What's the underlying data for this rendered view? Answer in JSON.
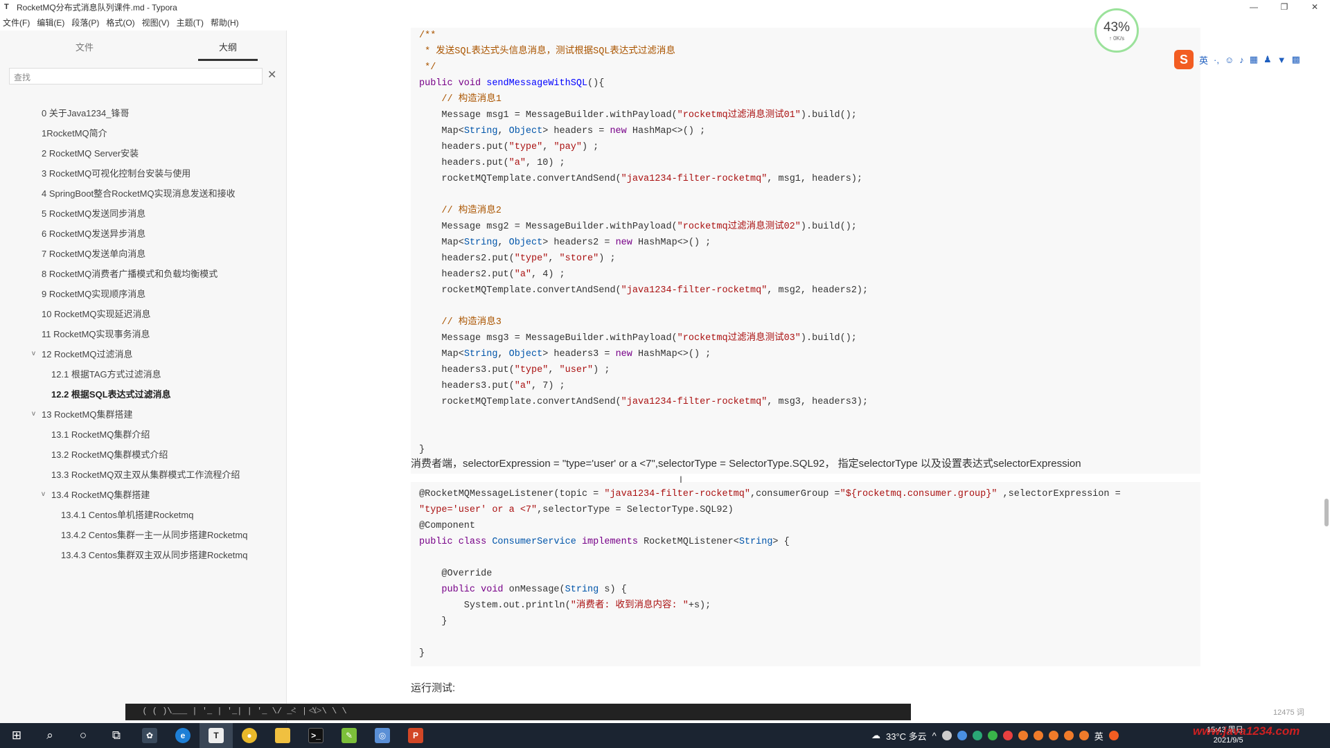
{
  "window": {
    "app_icon": "T",
    "title": "RocketMQ分布式消息队列课件.md - Typora",
    "controls": [
      "—",
      "❐",
      "✕"
    ]
  },
  "menu": [
    "文件(F)",
    "编辑(E)",
    "段落(P)",
    "格式(O)",
    "视图(V)",
    "主题(T)",
    "帮助(H)"
  ],
  "sidebar": {
    "tabs": [
      "文件",
      "大纲"
    ],
    "active_tab": "大纲",
    "search_placeholder": "查找",
    "outline": [
      {
        "label": "0 关于Java1234_锋哥",
        "level": 1,
        "chev": ""
      },
      {
        "label": "1RocketMQ简介",
        "level": 1,
        "chev": ""
      },
      {
        "label": "2 RocketMQ Server安装",
        "level": 1,
        "chev": ""
      },
      {
        "label": "3 RocketMQ可视化控制台安装与使用",
        "level": 1,
        "chev": ""
      },
      {
        "label": "4 SpringBoot整合RocketMQ实现消息发送和接收",
        "level": 1,
        "chev": ""
      },
      {
        "label": "5 RocketMQ发送同步消息",
        "level": 1,
        "chev": ""
      },
      {
        "label": "6 RocketMQ发送异步消息",
        "level": 1,
        "chev": ""
      },
      {
        "label": "7 RocketMQ发送单向消息",
        "level": 1,
        "chev": ""
      },
      {
        "label": "8 RocketMQ消费者广播模式和负载均衡模式",
        "level": 1,
        "chev": ""
      },
      {
        "label": "9 RocketMQ实现顺序消息",
        "level": 1,
        "chev": ""
      },
      {
        "label": "10 RocketMQ实现延迟消息",
        "level": 1,
        "chev": ""
      },
      {
        "label": "11 RocketMQ实现事务消息",
        "level": 1,
        "chev": ""
      },
      {
        "label": "12 RocketMQ过滤消息",
        "level": 1,
        "chev": "v"
      },
      {
        "label": "12.1 根据TAG方式过滤消息",
        "level": 2,
        "chev": ""
      },
      {
        "label": "12.2 根据SQL表达式过滤消息",
        "level": 2,
        "chev": "",
        "bold": true
      },
      {
        "label": "13 RocketMQ集群搭建",
        "level": 1,
        "chev": "v"
      },
      {
        "label": "13.1 RocketMQ集群介绍",
        "level": 2,
        "chev": ""
      },
      {
        "label": "13.2 RocketMQ集群模式介绍",
        "level": 2,
        "chev": ""
      },
      {
        "label": "13.3 RocketMQ双主双从集群模式工作流程介绍",
        "level": 2,
        "chev": ""
      },
      {
        "label": "13.4 RocketMQ集群搭建",
        "level": 2,
        "chev": "v"
      },
      {
        "label": "13.4.1 Centos单机搭建Rocketmq",
        "level": 3,
        "chev": ""
      },
      {
        "label": "13.4.2 Centos集群一主一从同步搭建Rocketmq",
        "level": 3,
        "chev": ""
      },
      {
        "label": "13.4.3 Centos集群双主双从同步搭建Rocketmq",
        "level": 3,
        "chev": ""
      }
    ],
    "footer_left": "<",
    "footer_code": "</>"
  },
  "code1": [
    [
      [
        "cmt",
        "/**"
      ]
    ],
    [
      [
        "cmt",
        " * 发送SQL表达式头信息消息，测试根据SQL表达式过滤消息"
      ]
    ],
    [
      [
        "cmt",
        " */"
      ]
    ],
    [
      [
        "kw",
        "public void "
      ],
      [
        "fn",
        "sendMessageWithSQL"
      ],
      [
        "",
        "(){"
      ]
    ],
    [
      [
        "",
        "    "
      ],
      [
        "cmt",
        "// 构造消息1"
      ]
    ],
    [
      [
        "",
        "    Message msg1 = MessageBuilder.withPayload("
      ],
      [
        "str",
        "\"rocketmq过滤消息测试01\""
      ],
      [
        "",
        ").build();"
      ]
    ],
    [
      [
        "",
        "    Map<"
      ],
      [
        "typ",
        "String"
      ],
      [
        "",
        ", "
      ],
      [
        "typ",
        "Object"
      ],
      [
        "",
        "> headers = "
      ],
      [
        "kw",
        "new "
      ],
      [
        "",
        "HashMap<>() ;"
      ]
    ],
    [
      [
        "",
        "    headers.put("
      ],
      [
        "str",
        "\"type\""
      ],
      [
        "",
        ", "
      ],
      [
        "str",
        "\"pay\""
      ],
      [
        "",
        ") ;"
      ]
    ],
    [
      [
        "",
        "    headers.put("
      ],
      [
        "str",
        "\"a\""
      ],
      [
        "",
        ", 10) ;"
      ]
    ],
    [
      [
        "",
        "    rocketMQTemplate.convertAndSend("
      ],
      [
        "str",
        "\"java1234-filter-rocketmq\""
      ],
      [
        "",
        ", msg1, headers);"
      ]
    ],
    [
      [
        "",
        ""
      ]
    ],
    [
      [
        "",
        "    "
      ],
      [
        "cmt",
        "// 构造消息2"
      ]
    ],
    [
      [
        "",
        "    Message msg2 = MessageBuilder.withPayload("
      ],
      [
        "str",
        "\"rocketmq过滤消息测试02\""
      ],
      [
        "",
        ").build();"
      ]
    ],
    [
      [
        "",
        "    Map<"
      ],
      [
        "typ",
        "String"
      ],
      [
        "",
        ", "
      ],
      [
        "typ",
        "Object"
      ],
      [
        "",
        "> headers2 = "
      ],
      [
        "kw",
        "new "
      ],
      [
        "",
        "HashMap<>() ;"
      ]
    ],
    [
      [
        "",
        "    headers2.put("
      ],
      [
        "str",
        "\"type\""
      ],
      [
        "",
        ", "
      ],
      [
        "str",
        "\"store\""
      ],
      [
        "",
        ") ;"
      ]
    ],
    [
      [
        "",
        "    headers2.put("
      ],
      [
        "str",
        "\"a\""
      ],
      [
        "",
        ", 4) ;"
      ]
    ],
    [
      [
        "",
        "    rocketMQTemplate.convertAndSend("
      ],
      [
        "str",
        "\"java1234-filter-rocketmq\""
      ],
      [
        "",
        ", msg2, headers2);"
      ]
    ],
    [
      [
        "",
        ""
      ]
    ],
    [
      [
        "",
        "    "
      ],
      [
        "cmt",
        "// 构造消息3"
      ]
    ],
    [
      [
        "",
        "    Message msg3 = MessageBuilder.withPayload("
      ],
      [
        "str",
        "\"rocketmq过滤消息测试03\""
      ],
      [
        "",
        ").build();"
      ]
    ],
    [
      [
        "",
        "    Map<"
      ],
      [
        "typ",
        "String"
      ],
      [
        "",
        ", "
      ],
      [
        "typ",
        "Object"
      ],
      [
        "",
        "> headers3 = "
      ],
      [
        "kw",
        "new "
      ],
      [
        "",
        "HashMap<>() ;"
      ]
    ],
    [
      [
        "",
        "    headers3.put("
      ],
      [
        "str",
        "\"type\""
      ],
      [
        "",
        ", "
      ],
      [
        "str",
        "\"user\""
      ],
      [
        "",
        ") ;"
      ]
    ],
    [
      [
        "",
        "    headers3.put("
      ],
      [
        "str",
        "\"a\""
      ],
      [
        "",
        ", 7) ;"
      ]
    ],
    [
      [
        "",
        "    rocketMQTemplate.convertAndSend("
      ],
      [
        "str",
        "\"java1234-filter-rocketmq\""
      ],
      [
        "",
        ", msg3, headers3);"
      ]
    ],
    [
      [
        "",
        ""
      ]
    ],
    [
      [
        "",
        ""
      ]
    ],
    [
      [
        "",
        "}"
      ]
    ]
  ],
  "para1": "消费者端，selectorExpression = \"type='user' or a <7\",selectorType = SelectorType.SQL92， 指定selectorType 以及设置表达式selectorExpression",
  "code2": [
    [
      [
        "",
        "@RocketMQMessageListener(topic = "
      ],
      [
        "str",
        "\"java1234-filter-rocketmq\""
      ],
      [
        "",
        ",consumerGroup ="
      ],
      [
        "str",
        "\"${rocketmq.consumer.group}\""
      ],
      [
        "",
        " ,selectorExpression ="
      ]
    ],
    [
      [
        "str",
        "\"type='user' or a <7\""
      ],
      [
        "",
        ",selectorType = SelectorType.SQL92)"
      ]
    ],
    [
      [
        "",
        "@Component"
      ]
    ],
    [
      [
        "kw",
        "public class "
      ],
      [
        "typ",
        "ConsumerService "
      ],
      [
        "kw",
        "implements "
      ],
      [
        "",
        "RocketMQListener<"
      ],
      [
        "typ",
        "String"
      ],
      [
        "",
        "> {"
      ]
    ],
    [
      [
        "",
        ""
      ]
    ],
    [
      [
        "",
        "    @Override"
      ]
    ],
    [
      [
        "",
        "    "
      ],
      [
        "kw",
        "public void "
      ],
      [
        "",
        "onMessage("
      ],
      [
        "typ",
        "String "
      ],
      [
        "",
        "s) {"
      ]
    ],
    [
      [
        "",
        "        System.out.println("
      ],
      [
        "str",
        "\"消费者: 收到消息内容: \""
      ],
      [
        "",
        "+s);"
      ]
    ],
    [
      [
        "",
        "    }"
      ]
    ],
    [
      [
        "",
        ""
      ]
    ],
    [
      [
        "",
        "}"
      ]
    ]
  ],
  "para2": "运行测试:",
  "terminal_text": "  ( ( )\\___ | '_ | '_| | '_ \\/ _` | \\ \\ \\ \\",
  "word_count": "12475 词",
  "speed_widget": {
    "percent": "43%",
    "rate": "↑ 0K/s"
  },
  "ime": {
    "logo": "S",
    "mode": "英",
    "extra": "·,"
  },
  "taskbar": {
    "icons": [
      "windows-start",
      "search",
      "cortana",
      "task-view",
      "app-1",
      "edge",
      "typora",
      "chrome",
      "explorer",
      "terminal",
      "notepad",
      "app-2",
      "ppt"
    ],
    "weather": "33°C 多云",
    "lang": "英",
    "time": "15:43 周日",
    "date": "2021/9/5",
    "watermark": "www.java1234.com"
  },
  "colors": {
    "keyword": "#770088",
    "string": "#aa1111",
    "comment": "#aa5500",
    "type": "#0055aa",
    "taskbar": "#1b2431"
  }
}
